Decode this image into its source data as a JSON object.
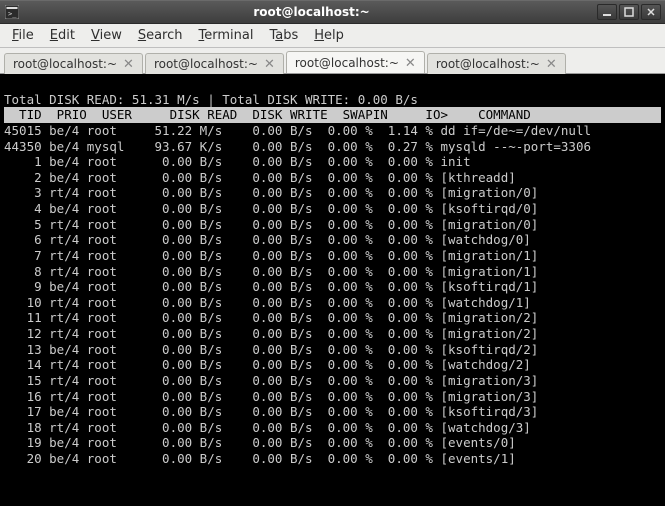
{
  "window": {
    "title": "root@localhost:~"
  },
  "menu": {
    "file": "File",
    "edit": "Edit",
    "view": "View",
    "search": "Search",
    "terminal": "Terminal",
    "tabs": "Tabs",
    "help": "Help"
  },
  "tabs": [
    {
      "label": "root@localhost:~",
      "active": false
    },
    {
      "label": "root@localhost:~",
      "active": false
    },
    {
      "label": "root@localhost:~",
      "active": true
    },
    {
      "label": "root@localhost:~",
      "active": false
    }
  ],
  "iotop": {
    "summary": "Total DISK READ: 51.31 M/s | Total DISK WRITE: 0.00 B/s",
    "header": "  TID  PRIO  USER     DISK READ  DISK WRITE  SWAPIN     IO>    COMMAND          ",
    "rows": [
      {
        "tid": "45015",
        "prio": "be/4",
        "user": "root",
        "read": "51.22 M/s",
        "write": "0.00 B/s",
        "swapin": "0.00 %",
        "io": "1.14 %",
        "cmd": "dd if=/de~=/dev/null"
      },
      {
        "tid": "44350",
        "prio": "be/4",
        "user": "mysql",
        "read": "93.67 K/s",
        "write": "0.00 B/s",
        "swapin": "0.00 %",
        "io": "0.27 %",
        "cmd": "mysqld --~-port=3306"
      },
      {
        "tid": "1",
        "prio": "be/4",
        "user": "root",
        "read": "0.00 B/s",
        "write": "0.00 B/s",
        "swapin": "0.00 %",
        "io": "0.00 %",
        "cmd": "init"
      },
      {
        "tid": "2",
        "prio": "be/4",
        "user": "root",
        "read": "0.00 B/s",
        "write": "0.00 B/s",
        "swapin": "0.00 %",
        "io": "0.00 %",
        "cmd": "[kthreadd]"
      },
      {
        "tid": "3",
        "prio": "rt/4",
        "user": "root",
        "read": "0.00 B/s",
        "write": "0.00 B/s",
        "swapin": "0.00 %",
        "io": "0.00 %",
        "cmd": "[migration/0]"
      },
      {
        "tid": "4",
        "prio": "be/4",
        "user": "root",
        "read": "0.00 B/s",
        "write": "0.00 B/s",
        "swapin": "0.00 %",
        "io": "0.00 %",
        "cmd": "[ksoftirqd/0]"
      },
      {
        "tid": "5",
        "prio": "rt/4",
        "user": "root",
        "read": "0.00 B/s",
        "write": "0.00 B/s",
        "swapin": "0.00 %",
        "io": "0.00 %",
        "cmd": "[migration/0]"
      },
      {
        "tid": "6",
        "prio": "rt/4",
        "user": "root",
        "read": "0.00 B/s",
        "write": "0.00 B/s",
        "swapin": "0.00 %",
        "io": "0.00 %",
        "cmd": "[watchdog/0]"
      },
      {
        "tid": "7",
        "prio": "rt/4",
        "user": "root",
        "read": "0.00 B/s",
        "write": "0.00 B/s",
        "swapin": "0.00 %",
        "io": "0.00 %",
        "cmd": "[migration/1]"
      },
      {
        "tid": "8",
        "prio": "rt/4",
        "user": "root",
        "read": "0.00 B/s",
        "write": "0.00 B/s",
        "swapin": "0.00 %",
        "io": "0.00 %",
        "cmd": "[migration/1]"
      },
      {
        "tid": "9",
        "prio": "be/4",
        "user": "root",
        "read": "0.00 B/s",
        "write": "0.00 B/s",
        "swapin": "0.00 %",
        "io": "0.00 %",
        "cmd": "[ksoftirqd/1]"
      },
      {
        "tid": "10",
        "prio": "rt/4",
        "user": "root",
        "read": "0.00 B/s",
        "write": "0.00 B/s",
        "swapin": "0.00 %",
        "io": "0.00 %",
        "cmd": "[watchdog/1]"
      },
      {
        "tid": "11",
        "prio": "rt/4",
        "user": "root",
        "read": "0.00 B/s",
        "write": "0.00 B/s",
        "swapin": "0.00 %",
        "io": "0.00 %",
        "cmd": "[migration/2]"
      },
      {
        "tid": "12",
        "prio": "rt/4",
        "user": "root",
        "read": "0.00 B/s",
        "write": "0.00 B/s",
        "swapin": "0.00 %",
        "io": "0.00 %",
        "cmd": "[migration/2]"
      },
      {
        "tid": "13",
        "prio": "be/4",
        "user": "root",
        "read": "0.00 B/s",
        "write": "0.00 B/s",
        "swapin": "0.00 %",
        "io": "0.00 %",
        "cmd": "[ksoftirqd/2]"
      },
      {
        "tid": "14",
        "prio": "rt/4",
        "user": "root",
        "read": "0.00 B/s",
        "write": "0.00 B/s",
        "swapin": "0.00 %",
        "io": "0.00 %",
        "cmd": "[watchdog/2]"
      },
      {
        "tid": "15",
        "prio": "rt/4",
        "user": "root",
        "read": "0.00 B/s",
        "write": "0.00 B/s",
        "swapin": "0.00 %",
        "io": "0.00 %",
        "cmd": "[migration/3]"
      },
      {
        "tid": "16",
        "prio": "rt/4",
        "user": "root",
        "read": "0.00 B/s",
        "write": "0.00 B/s",
        "swapin": "0.00 %",
        "io": "0.00 %",
        "cmd": "[migration/3]"
      },
      {
        "tid": "17",
        "prio": "be/4",
        "user": "root",
        "read": "0.00 B/s",
        "write": "0.00 B/s",
        "swapin": "0.00 %",
        "io": "0.00 %",
        "cmd": "[ksoftirqd/3]"
      },
      {
        "tid": "18",
        "prio": "rt/4",
        "user": "root",
        "read": "0.00 B/s",
        "write": "0.00 B/s",
        "swapin": "0.00 %",
        "io": "0.00 %",
        "cmd": "[watchdog/3]"
      },
      {
        "tid": "19",
        "prio": "be/4",
        "user": "root",
        "read": "0.00 B/s",
        "write": "0.00 B/s",
        "swapin": "0.00 %",
        "io": "0.00 %",
        "cmd": "[events/0]"
      },
      {
        "tid": "20",
        "prio": "be/4",
        "user": "root",
        "read": "0.00 B/s",
        "write": "0.00 B/s",
        "swapin": "0.00 %",
        "io": "0.00 %",
        "cmd": "[events/1]"
      }
    ]
  }
}
